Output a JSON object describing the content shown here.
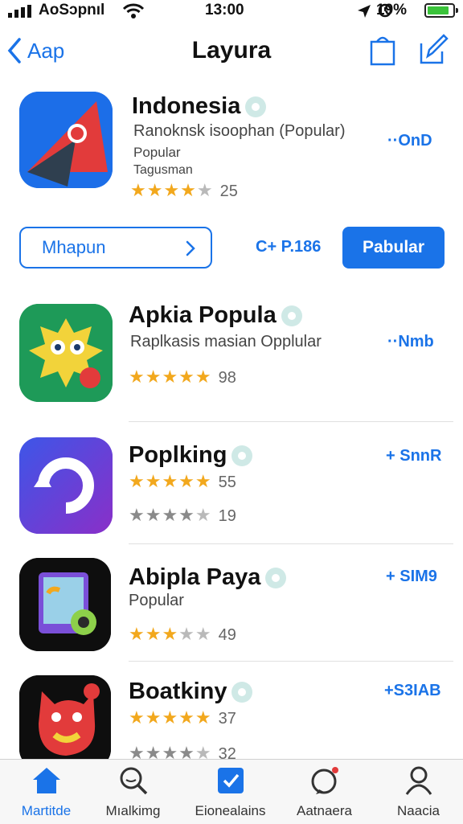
{
  "status_bar": {
    "carrier": "AoSɔpnıl",
    "time": "13:00",
    "battery": "19%"
  },
  "nav": {
    "back_label": "Aap",
    "title": "Layura"
  },
  "featured": {
    "name": "Indonesia",
    "subtitle": "Ranoknsk isoophan (Popular)",
    "line2": "Popular",
    "line3": "Tagusman",
    "rating_count": "25",
    "price": "··OnD",
    "outline_button": "Mhapun",
    "mid_price": "C+ P.186",
    "primary_button": "Pabular"
  },
  "apps": [
    {
      "name": "Apkia Popula",
      "subtitle": "Raplkasis masian Opplular",
      "rating_count": "98",
      "price": "··Nmb"
    },
    {
      "name": "Poplking",
      "rating_count": "55",
      "rating_count_2": "19",
      "price": "+ SnnR"
    },
    {
      "name": "Abipla Paya",
      "subtitle": "Popular",
      "rating_count": "49",
      "price": "+ SIM9"
    },
    {
      "name": "Boatkiny",
      "rating_count": "37",
      "rating_count_2": "32",
      "price": "+S3IAB"
    }
  ],
  "tabs": [
    {
      "label": "Martitde",
      "icon": "home-icon",
      "active": true
    },
    {
      "label": "Mıalkimg",
      "icon": "search-icon"
    },
    {
      "label": "Eionealains",
      "icon": "apps-icon"
    },
    {
      "label": "Aatnaera",
      "icon": "chat-icon"
    },
    {
      "label": "Naacia",
      "icon": "person-icon"
    }
  ],
  "colors": {
    "accent": "#1a73e8",
    "star": "#f2a81d",
    "battery": "#3ac33a"
  }
}
